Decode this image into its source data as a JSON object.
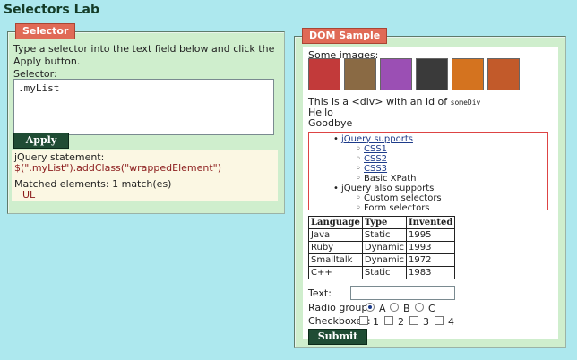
{
  "page": {
    "title": "Selectors Lab"
  },
  "selector_panel": {
    "legend": "Selector",
    "instructions": "Type a selector into the text field below and click the Apply button.",
    "selector_label": "Selector:",
    "selector_value": ".myList",
    "apply_label": "Apply",
    "statement_label": "jQuery statement:",
    "statement": "$(\".myList\").addClass(\"wrappedElement\")",
    "matched_label": "Matched elements: 1 match(es)",
    "matched_item": "UL"
  },
  "dom_panel": {
    "legend": "DOM Sample",
    "images_label": "Some images:",
    "images": [
      {
        "name": "flower-red",
        "color": "#c23a3a"
      },
      {
        "name": "dog",
        "color": "#8a6a44"
      },
      {
        "name": "flower-purple",
        "color": "#9b4fb4"
      },
      {
        "name": "dog-dark",
        "color": "#3a3a3a"
      },
      {
        "name": "flower-orange",
        "color": "#d4731f"
      },
      {
        "name": "flower-pot",
        "color": "#c25a2a"
      }
    ],
    "div_text_prefix": "This is a <div> with an id of ",
    "div_id": "someDiv",
    "hello": "Hello",
    "goodbye": "Goodbye",
    "list": {
      "item1": "jQuery supports",
      "sub1": [
        "CSS1",
        "CSS2",
        "CSS3",
        "Basic XPath"
      ],
      "item2": "jQuery also supports",
      "sub2": [
        "Custom selectors",
        "Form selectors"
      ]
    },
    "table": {
      "headers": [
        "Language",
        "Type",
        "Invented"
      ],
      "rows": [
        [
          "Java",
          "Static",
          "1995"
        ],
        [
          "Ruby",
          "Dynamic",
          "1993"
        ],
        [
          "Smalltalk",
          "Dynamic",
          "1972"
        ],
        [
          "C++",
          "Static",
          "1983"
        ]
      ]
    },
    "text_label": "Text:",
    "radio_label": "Radio group:",
    "radio_options": [
      "A",
      "B",
      "C"
    ],
    "radio_selected": "A",
    "checkbox_label": "Checkboxes:",
    "checkbox_options": [
      "1",
      "2",
      "3",
      "4"
    ],
    "submit_label": "Submit"
  }
}
